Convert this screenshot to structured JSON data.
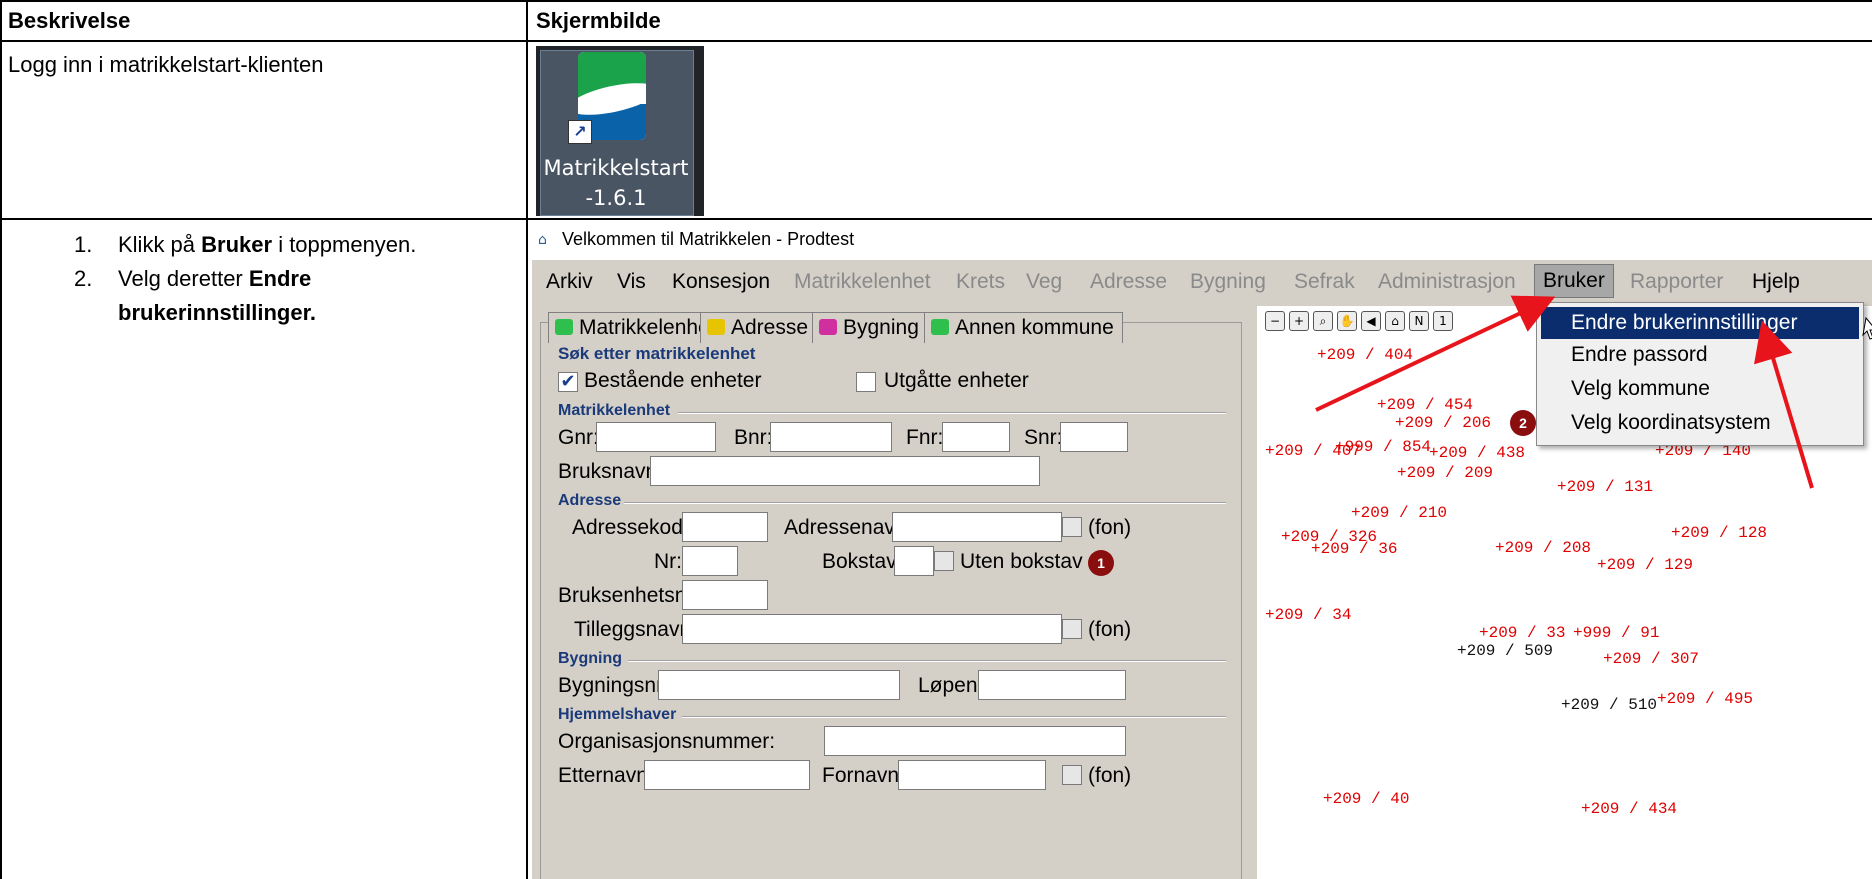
{
  "table": {
    "header_col1": "Beskrivelse",
    "header_col2": "Skjermbilde",
    "row1_text": "Logg inn i matrikkelstart-klienten",
    "row2_step1_num": "1.",
    "row2_step1_pre": "Klikk på ",
    "row2_step1_bold": "Bruker",
    "row2_step1_post": " i toppmenyen.",
    "row2_step2_num": "2.",
    "row2_step2_pre": "Velg deretter ",
    "row2_step2_bold1": "Endre",
    "row2_step2_bold2": "brukerinnstillinger."
  },
  "desktop_icon": {
    "line1": "Matrikkelstart",
    "line2": "-1.6.1"
  },
  "app": {
    "title": "Velkommen til Matrikkelen - Prodtest",
    "menu": [
      "Arkiv",
      "Vis",
      "Konsesjon",
      "Matrikkelenhet",
      "Krets",
      "Veg",
      "Adresse",
      "Bygning",
      "Sefrak",
      "Administrasjon",
      "Bruker",
      "Rapporter",
      "Hjelp"
    ],
    "tabs": [
      "Matrikkelenhet",
      "Adresse",
      "Bygning",
      "Annen kommune"
    ],
    "sok": {
      "section": "Søk etter matrikkelenhet",
      "bestaende": "Bestående enheter",
      "utgatte": "Utgåtte enheter"
    },
    "matrikkelenhet": {
      "section": "Matrikkelenhet",
      "gnr": "Gnr:",
      "bnr": "Bnr:",
      "fnr": "Fnr:",
      "snr": "Snr:",
      "bruksnavn": "Bruksnavn:"
    },
    "adresse": {
      "section": "Adresse",
      "adressekode": "Adressekode:",
      "adressenavn": "Adressenavn:",
      "fon": "(fon)",
      "nr": "Nr:",
      "bokstav": "Bokstav:",
      "uten_bokstav": "Uten bokstav",
      "bruksenhetsnr": "Bruksenhetsnr:",
      "tilleggsnavn": "Tilleggsnavn:"
    },
    "bygning": {
      "section": "Bygning",
      "bygningsnr": "Bygningsnr:",
      "lopenr": "Løpenr:"
    },
    "hjemmelshaver": {
      "section": "Hjemmelshaver",
      "orgnr": "Organisasjonsnummer:",
      "etternavn": "Etternavn:",
      "fornavn": "Fornavn:"
    },
    "dropdown": [
      "Endre brukerinnstillinger",
      "Endre passord",
      "Velg kommune",
      "Velg koordinatsystem"
    ],
    "map_points": [
      "+209 / 404",
      "+209 / 454",
      "+209 / 206",
      "+209 / 407",
      "+999 / 854",
      "+209 / 438",
      "+209 / 209",
      "+209 / 140",
      "+209 / 131",
      "+209 / 210",
      "+209 / 128",
      "+209 / 326",
      "+209 / 36",
      "+209 / 208",
      "+209 / 129",
      "+209 / 34",
      "+209 / 33",
      "+999 / 91",
      "+209 / 509",
      "+209 / 307",
      "+209 / 510",
      "+209 / 495",
      "+209 / 40",
      "+209 / 434"
    ],
    "badges": [
      "1",
      "2"
    ]
  },
  "colors": {
    "menu_highlight": "#0b2d6e",
    "annotation": "#e8141b",
    "point": "#e00000"
  }
}
